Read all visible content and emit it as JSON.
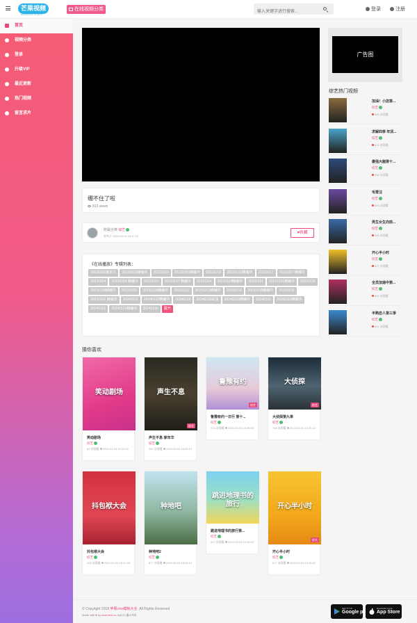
{
  "header": {
    "logo": "芒果视频",
    "logo_tagline": "MANGGUO SHIPIN",
    "category_button": "在线视频分类",
    "search_placeholder": "输入关键字进行搜索...",
    "login": "登录",
    "register": "注册"
  },
  "sidebar": {
    "items": [
      {
        "label": "首页",
        "icon": "home-icon",
        "active": true
      },
      {
        "label": "视频分类",
        "icon": "grid-icon",
        "active": false
      },
      {
        "label": "登录",
        "icon": "user-icon",
        "active": false
      },
      {
        "label": "升级VIP",
        "icon": "crown-icon",
        "active": false
      },
      {
        "label": "最近更新",
        "icon": "refresh-icon",
        "active": false
      },
      {
        "label": "热门视频",
        "icon": "fire-icon",
        "active": false
      },
      {
        "label": "留言求片",
        "icon": "message-icon",
        "active": false
      }
    ]
  },
  "video": {
    "title": "绷不住了啦",
    "views": "813 views",
    "category_prefix": "所属分类",
    "category": "综艺",
    "published": "发布于 2024-03-03 15:27:24",
    "favorite": "收藏"
  },
  "episodes": {
    "heading": "《在线播放》专辑列表：",
    "items": [
      "20230926第末子",
      "20230926精编中",
      "20231003",
      "20231003精编中",
      "20231010",
      "20231010精编中",
      "20231017",
      "20231017精编中",
      "20231024",
      "20231024 精编中",
      "20231107",
      "20231107 精编中",
      "20231114",
      "20231114精编中",
      "20231121",
      "20231121精编中",
      "20231128",
      "20231128精编中",
      "20231205",
      "20231205精编中",
      "20231212",
      "20231212精编中",
      "20231219",
      "20231219精编中",
      "20231226",
      "20231226 精编中",
      "20240102",
      "20240102精编中",
      "20240109",
      "20240109彩蛋",
      "20240109精编中",
      "20240116",
      "20240116精编中",
      "20240123",
      "20240123精编中",
      "20240130"
    ],
    "expand": "展开"
  },
  "recommend": {
    "heading": "猜你喜欢",
    "items": [
      {
        "title": "笑动剧场",
        "category": "综艺",
        "views": "82 次观看",
        "date": "2024-03-03 15:24:32",
        "poster_text": "笑动剧场"
      },
      {
        "title": "声生不息·家年华",
        "category": "综艺",
        "views": "280 次观看",
        "date": "2024-03-03 15:25:13",
        "poster_text": "声生不息",
        "badge": "综艺"
      },
      {
        "title": "鲁豫有约一日行 第十...",
        "category": "综艺",
        "views": "374 次观看",
        "date": "2024-03-03 15:26:59",
        "poster_text": "鲁豫有约",
        "badge": "综艺"
      },
      {
        "title": "大侦探第九季",
        "category": "综艺",
        "views": "798 次观看",
        "date": "2024-03-03 15:25:12",
        "poster_text": "大侦探",
        "badge": "综艺"
      },
      {
        "title": "抖包袱大会",
        "category": "综艺",
        "views": "208 次观看",
        "date": "2024-03-03 15:21:03",
        "poster_text": "抖包袱大会"
      },
      {
        "title": "种地吧2",
        "category": "综艺",
        "views": "877 次观看",
        "date": "2024-03-03 15:23:12",
        "poster_text": "种地吧"
      },
      {
        "title": "跳进地理书的旅行第...",
        "category": "综艺",
        "views": "927 次观看",
        "date": "2024-03-03 15:28:09",
        "poster_text": "跳进地理书的旅行"
      },
      {
        "title": "开心半小时",
        "category": "综艺",
        "views": "617 次观看",
        "date": "2024-03-03 15:25:42",
        "poster_text": "开心半小时",
        "badge": "综艺"
      }
    ]
  },
  "ad": {
    "label": "广告图"
  },
  "hot": {
    "heading": "综艺热门视频",
    "items": [
      {
        "title": "加油！小店第...",
        "category": "综艺",
        "views": "598 次观看"
      },
      {
        "title": "求解四季 年货...",
        "category": "综艺",
        "views": "878 次观看"
      },
      {
        "title": "最强大脑第十...",
        "category": "综艺",
        "views": "558 次观看"
      },
      {
        "title": "毛雪汪",
        "category": "综艺",
        "views": "809 次观看"
      },
      {
        "title": "男生女生向前...",
        "category": "综艺",
        "views": "098 次观看"
      },
      {
        "title": "开心半小时",
        "category": "综艺",
        "views": "617 次观看"
      },
      {
        "title": "全员加速中第...",
        "category": "综艺",
        "views": "681 次观看"
      },
      {
        "title": "半熟恋人第三季",
        "category": "综艺",
        "views": "891 次观看"
      }
    ]
  },
  "footer": {
    "copyright_prefix": "© Copyright 2018",
    "site_name": "苹果cms模板大全",
    "copyright_suffix": ". All Rights Reserved",
    "made_prefix": "Made with",
    "made_by": "by",
    "made_link": "www.test.cn",
    "icp": "icp123 备ICP码",
    "google_small": "GET IT ON",
    "google_big": "Google play",
    "apple_small": "Download on the",
    "apple_big": "App Store"
  }
}
